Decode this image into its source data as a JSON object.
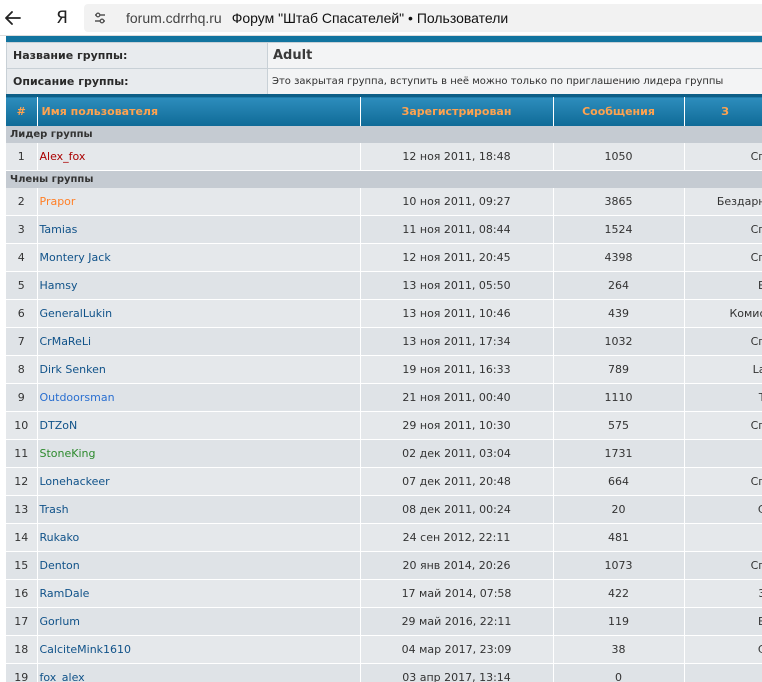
{
  "browser": {
    "domain": "forum.cdrrhq.ru",
    "title": "Форум \"Штаб Спасателей\" • Пользователи",
    "logo": "Я"
  },
  "group": {
    "name_label": "Название группы:",
    "name_value": "Adult",
    "desc_label": "Описание группы:",
    "desc_value": "Это закрытая группа, вступить в неё можно только по приглашению лидера группы"
  },
  "table": {
    "headers": {
      "num": "#",
      "user": "Имя пользователя",
      "registered": "Зарегистрирован",
      "posts": "Сообщения",
      "extra": "З"
    },
    "leader_section": "Лидер группы",
    "members_section": "Члены группы",
    "leader": {
      "num": "1",
      "name": "Alex_fox",
      "color": "#aa0000",
      "date": "12 ноя 2011, 18:48",
      "posts": "1050",
      "extra": "Сп"
    },
    "members": [
      {
        "num": "2",
        "name": "Prapor",
        "color": "#ff7f27",
        "date": "10 ноя 2011, 09:27",
        "posts": "3865",
        "extra": "Бездарн"
      },
      {
        "num": "3",
        "name": "Tamias",
        "color": "#105289",
        "date": "11 ноя 2011, 08:44",
        "posts": "1524",
        "extra": "Сп"
      },
      {
        "num": "4",
        "name": "Montery Jack",
        "color": "#105289",
        "date": "12 ноя 2011, 20:45",
        "posts": "4398",
        "extra": "Сп"
      },
      {
        "num": "5",
        "name": "Hamsy",
        "color": "#105289",
        "date": "13 ноя 2011, 05:50",
        "posts": "264",
        "extra": "В"
      },
      {
        "num": "6",
        "name": "GeneralLukin",
        "color": "#105289",
        "date": "13 ноя 2011, 10:46",
        "posts": "439",
        "extra": "Комис"
      },
      {
        "num": "7",
        "name": "CrMaReLi",
        "color": "#105289",
        "date": "13 ноя 2011, 17:34",
        "posts": "1032",
        "extra": "Сп"
      },
      {
        "num": "8",
        "name": "Dirk Senken",
        "color": "#105289",
        "date": "19 ноя 2011, 16:33",
        "posts": "789",
        "extra": "La"
      },
      {
        "num": "9",
        "name": "Outdoorsman",
        "color": "#2a6fd0",
        "date": "21 ноя 2011, 00:40",
        "posts": "1110",
        "extra": "Т"
      },
      {
        "num": "10",
        "name": "DTZoN",
        "color": "#105289",
        "date": "29 ноя 2011, 10:30",
        "posts": "575",
        "extra": "Сп"
      },
      {
        "num": "11",
        "name": "StoneKing",
        "color": "#2d8a2d",
        "date": "02 дек 2011, 03:04",
        "posts": "1731",
        "extra": ""
      },
      {
        "num": "12",
        "name": "Lonehackeer",
        "color": "#105289",
        "date": "07 дек 2011, 20:48",
        "posts": "664",
        "extra": "Сп"
      },
      {
        "num": "13",
        "name": "Trash",
        "color": "#105289",
        "date": "08 дек 2011, 00:24",
        "posts": "20",
        "extra": "С"
      },
      {
        "num": "14",
        "name": "Rukako",
        "color": "#105289",
        "date": "24 сен 2012, 22:11",
        "posts": "481",
        "extra": ""
      },
      {
        "num": "15",
        "name": "Denton",
        "color": "#105289",
        "date": "20 янв 2014, 20:26",
        "posts": "1073",
        "extra": "Сп"
      },
      {
        "num": "16",
        "name": "RamDale",
        "color": "#105289",
        "date": "17 май 2014, 07:58",
        "posts": "422",
        "extra": "З"
      },
      {
        "num": "17",
        "name": "Gorlum",
        "color": "#105289",
        "date": "29 май 2016, 22:11",
        "posts": "119",
        "extra": "В"
      },
      {
        "num": "18",
        "name": "CalciteMink1610",
        "color": "#105289",
        "date": "04 мар 2017, 23:09",
        "posts": "38",
        "extra": "С"
      },
      {
        "num": "19",
        "name": "fox_alex",
        "color": "#105289",
        "date": "03 апр 2017, 13:14",
        "posts": "0",
        "extra": ""
      }
    ]
  }
}
